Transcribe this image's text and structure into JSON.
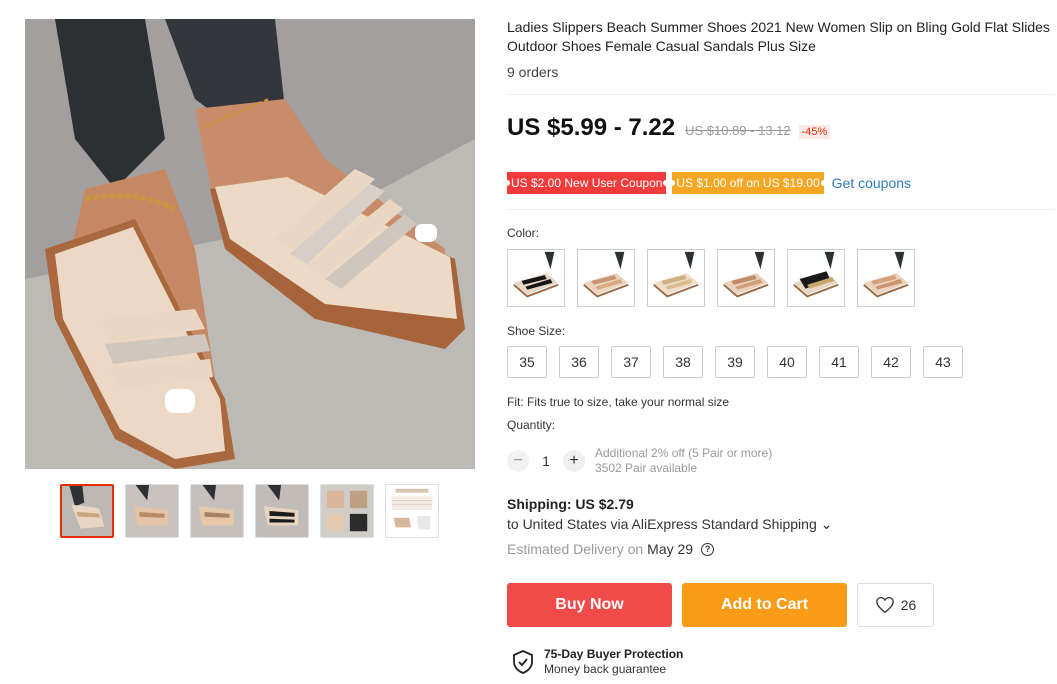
{
  "product": {
    "title": "Ladies Slippers Beach Summer Shoes 2021 New Women Slip on Bling Gold Flat Slides Outdoor Shoes Female Casual Sandals Plus Size",
    "orders": "9 orders"
  },
  "price": {
    "current": "US $5.99 - 7.22",
    "original": "US $10.89 - 13.12",
    "discount": "-45%"
  },
  "coupons": {
    "new_user": "US $2.00 New User Coupon",
    "store": "US $1.00 off on US $19.00",
    "get_link": "Get coupons"
  },
  "color": {
    "label": "Color:",
    "options": [
      "black-stripe",
      "rose-gold-1",
      "gold-1",
      "rose-gold-2",
      "black-gold",
      "rose-gold-3"
    ]
  },
  "size": {
    "label": "Shoe Size:",
    "options": [
      "35",
      "36",
      "37",
      "38",
      "39",
      "40",
      "41",
      "42",
      "43"
    ]
  },
  "fit": "Fit: Fits true to size, take your normal size",
  "quantity": {
    "label": "Quantity:",
    "value": "1",
    "minus": "−",
    "plus": "+",
    "note1": "Additional 2% off (5 Pair or more)",
    "note2": "3502 Pair available"
  },
  "shipping": {
    "title": "Shipping: US $2.79",
    "destination": "to United States via AliExpress Standard Shipping ⌄",
    "delivery_prefix": "Estimated Delivery on",
    "delivery_date": "May 29",
    "help": "?"
  },
  "actions": {
    "buy_now": "Buy Now",
    "add_to_cart": "Add to Cart",
    "wishlist_count": "26"
  },
  "protection": {
    "title": "75-Day Buyer Protection",
    "subtitle": "Money back guarantee"
  },
  "colors": {
    "accent_red": "#f04b49",
    "accent_orange": "#fa9c18",
    "link_blue": "#2e7ac0",
    "discount_red": "#e62e04"
  }
}
